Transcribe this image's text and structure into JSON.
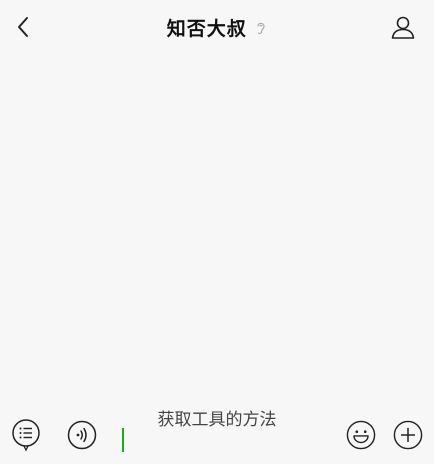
{
  "header": {
    "title": "知否大叔",
    "back_icon": "chevron-left-icon",
    "mode_icon": "ear-icon",
    "profile_icon": "person-icon"
  },
  "composer": {
    "suggestion": "获取工具的方法",
    "input_value": "",
    "menu_icon": "list-menu-icon",
    "voice_icon": "voice-icon",
    "emoji_icon": "smiley-icon",
    "plus_icon": "plus-icon",
    "caret_color": "#1aad19"
  }
}
